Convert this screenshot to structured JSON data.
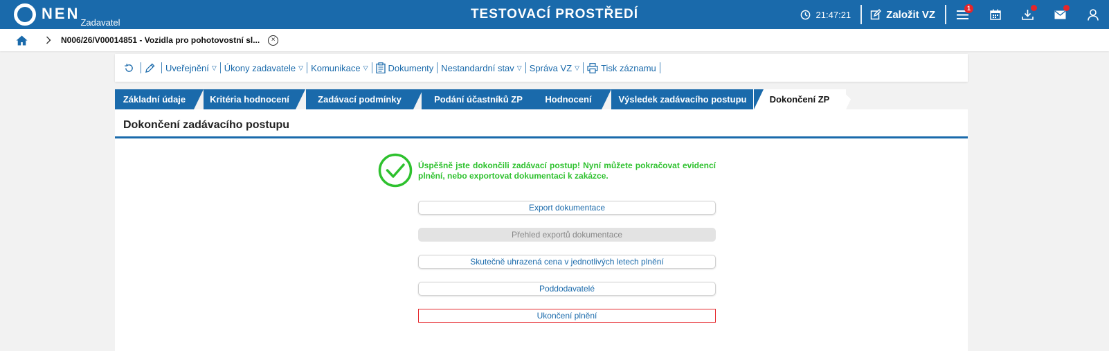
{
  "header": {
    "logo_text": "NEN",
    "logo_sub": "Zadavatel",
    "env_title": "TESTOVACÍ PROSTŘEDÍ",
    "time": "21:47:21",
    "create_label": "Založit VZ",
    "menu_badge": "1",
    "icons": [
      "clock-icon",
      "edit-icon",
      "menu-icon",
      "calendar-icon",
      "download-icon",
      "mail-icon",
      "user-icon"
    ],
    "brand_color": "#1a6aab",
    "badge_color": "#e5262b"
  },
  "breadcrumb": {
    "text": "N006/26/V00014851 - Vozidla pro pohotovostní sl...",
    "close": "×"
  },
  "toolbar": {
    "items": [
      {
        "label": "Uveřejnění",
        "caret": "▽"
      },
      {
        "label": "Úkony zadavatele",
        "caret": "▽"
      },
      {
        "label": "Komunikace",
        "caret": "▽"
      },
      {
        "label": "Dokumenty"
      },
      {
        "label": "Nestandardní stav",
        "caret": "▽"
      },
      {
        "label": "Správa VZ",
        "caret": "▽"
      },
      {
        "label": "Tisk záznamu"
      }
    ]
  },
  "tabs": [
    {
      "label": "Základní údaje"
    },
    {
      "label": "Kritéria hodnocení"
    },
    {
      "label": "Zadávací podmínky"
    },
    {
      "label": "Podání účastníků ZP"
    },
    {
      "label": "Hodnocení"
    },
    {
      "label": "Výsledek zadávacího postupu"
    },
    {
      "label": "Dokončení ZP",
      "active": true
    }
  ],
  "panel": {
    "title": "Dokončení zadávacího postupu",
    "success_message": "Úspěšně jste dokončili zadávací postup! Nyní můžete pokračovat evidencí plnění, nebo exportovat dokumentaci k zakázce.",
    "success_color": "#2ec12e",
    "buttons": [
      {
        "label": "Export dokumentace",
        "state": "enabled"
      },
      {
        "label": "Přehled exportů dokumentace",
        "state": "disabled"
      },
      {
        "label": "Skutečně uhrazená cena v jednotlivých letech plnění",
        "state": "enabled"
      },
      {
        "label": "Poddodavatelé",
        "state": "enabled"
      },
      {
        "label": "Ukončení plnění",
        "state": "highlighted"
      }
    ]
  }
}
